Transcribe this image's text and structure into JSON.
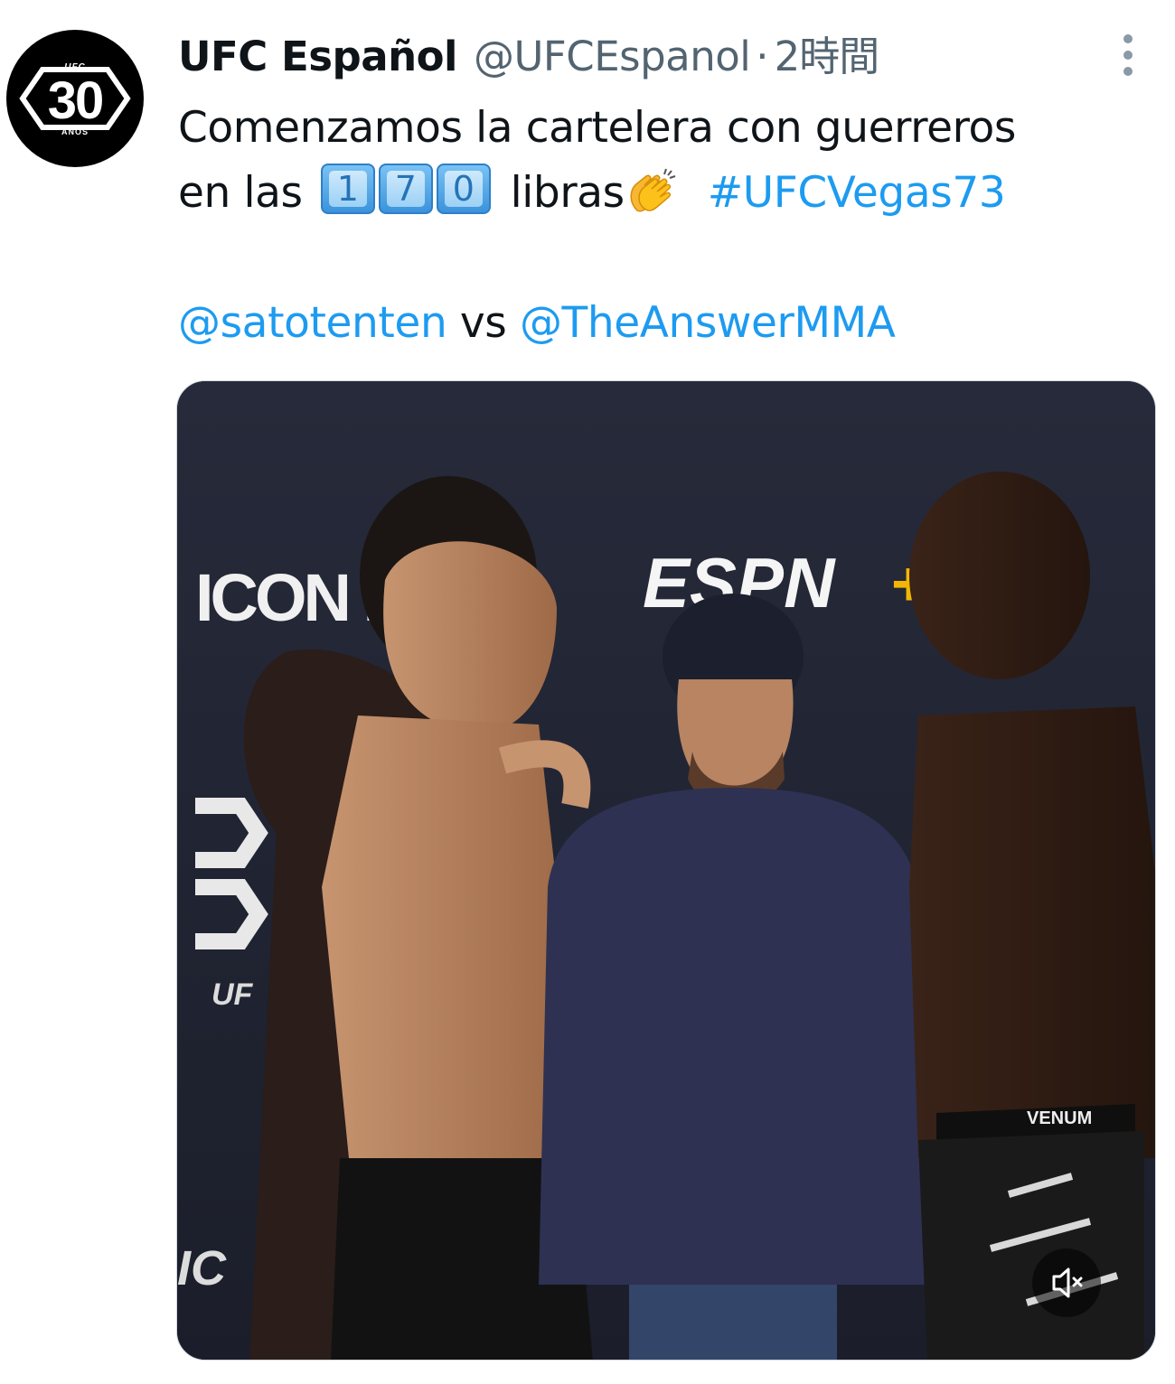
{
  "tweet": {
    "display_name": "UFC Español",
    "handle": "@UFCEspanol",
    "separator": "·",
    "time": "2時間",
    "avatar": {
      "top_text": "UFC",
      "number": "30",
      "bottom_text": "AÑOS"
    },
    "text": {
      "line1": "Comenzamos la cartelera con guerreros",
      "line2_prefix": "en las",
      "keycaps": [
        "1",
        "7",
        "0"
      ],
      "line2_word": "libras",
      "emoji": "clapping-hands",
      "hashtag": "#UFCVegas73",
      "mention_1": "@satotenten",
      "vs": "vs",
      "mention_2": "@TheAnswerMMA"
    },
    "media": {
      "type": "video",
      "backdrop_logos": [
        "ICON M",
        "ESPN+",
        "UF",
        "IC"
      ],
      "shorts_text": "VENUM",
      "muted": true
    }
  },
  "colors": {
    "link": "#1d9bf0",
    "secondary_text": "#536471",
    "primary_text": "#0f1419"
  }
}
